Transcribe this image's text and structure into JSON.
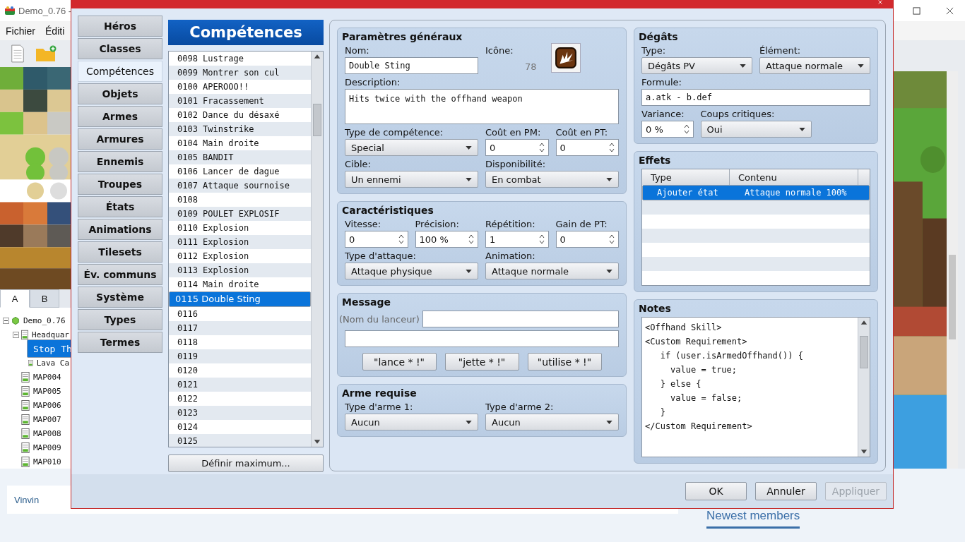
{
  "app": {
    "title": "Demo_0.76 -",
    "menu": [
      "Fichier",
      "Éditi"
    ],
    "palette_tabs": [
      {
        "label": "A",
        "selected": true
      },
      {
        "label": "B",
        "selected": false
      }
    ],
    "map_tree": [
      {
        "label": "Demo_0.76",
        "kind": "project",
        "expanded": true,
        "selected": false,
        "children": [
          {
            "label": "Headquar",
            "kind": "map",
            "expanded": true,
            "selected": false,
            "children": [
              {
                "label": "Stop Th",
                "kind": "map",
                "selected": true
              },
              {
                "label": "Lava Ca",
                "kind": "map",
                "selected": false
              }
            ]
          },
          {
            "label": "MAP004",
            "kind": "map",
            "selected": false
          },
          {
            "label": "MAP005",
            "kind": "map",
            "selected": false
          },
          {
            "label": "MAP006",
            "kind": "map",
            "selected": false
          },
          {
            "label": "MAP007",
            "kind": "map",
            "selected": false
          },
          {
            "label": "MAP008",
            "kind": "map",
            "selected": false
          },
          {
            "label": "MAP009",
            "kind": "map",
            "selected": false
          },
          {
            "label": "MAP010",
            "kind": "map",
            "selected": false
          }
        ]
      }
    ]
  },
  "web": {
    "post_author": "Vinvin",
    "sidebar_heading": "Newest members"
  },
  "dialog": {
    "nav": [
      {
        "label": "Héros",
        "selected": false
      },
      {
        "label": "Classes",
        "selected": false
      },
      {
        "label": "Compétences",
        "selected": true
      },
      {
        "label": "Objets",
        "selected": false
      },
      {
        "label": "Armes",
        "selected": false
      },
      {
        "label": "Armures",
        "selected": false
      },
      {
        "label": "Ennemis",
        "selected": false
      },
      {
        "label": "Troupes",
        "selected": false
      },
      {
        "label": "États",
        "selected": false
      },
      {
        "label": "Animations",
        "selected": false
      },
      {
        "label": "Tilesets",
        "selected": false
      },
      {
        "label": "Év. communs",
        "selected": false
      },
      {
        "label": "Système",
        "selected": false
      },
      {
        "label": "Types",
        "selected": false
      },
      {
        "label": "Termes",
        "selected": false
      }
    ],
    "list": {
      "title": "Compétences",
      "items": [
        {
          "label": "0098 Lustrage",
          "selected": false
        },
        {
          "label": "0099 Montrer son cul",
          "selected": false
        },
        {
          "label": "0100 APEROOO!!",
          "selected": false
        },
        {
          "label": "0101 Fracassement",
          "selected": false
        },
        {
          "label": "0102 Dance du désaxé",
          "selected": false
        },
        {
          "label": "0103 Twinstrike",
          "selected": false
        },
        {
          "label": "0104 Main droite",
          "selected": false
        },
        {
          "label": "0105 BANDIT",
          "selected": false
        },
        {
          "label": "0106 Lancer de dague",
          "selected": false
        },
        {
          "label": "0107 Attaque sournoise",
          "selected": false
        },
        {
          "label": "0108",
          "selected": false
        },
        {
          "label": "0109 POULET EXPLOSIF",
          "selected": false
        },
        {
          "label": "0110 Explosion",
          "selected": false
        },
        {
          "label": "0111 Explosion",
          "selected": false
        },
        {
          "label": "0112 Explosion",
          "selected": false
        },
        {
          "label": "0113 Explosion",
          "selected": false
        },
        {
          "label": "0114 Main droite",
          "selected": false
        },
        {
          "label": "0115 Double Sting",
          "selected": true
        },
        {
          "label": "0116",
          "selected": false
        },
        {
          "label": "0117",
          "selected": false
        },
        {
          "label": "0118",
          "selected": false
        },
        {
          "label": "0119",
          "selected": false
        },
        {
          "label": "0120",
          "selected": false
        },
        {
          "label": "0121",
          "selected": false
        },
        {
          "label": "0122",
          "selected": false
        },
        {
          "label": "0123",
          "selected": false
        },
        {
          "label": "0124",
          "selected": false
        },
        {
          "label": "0125",
          "selected": false
        }
      ],
      "max_button": "Définir maximum..."
    },
    "left_sections": [
      {
        "title": "Paramètres généraux",
        "rows": [
          {
            "fields": [
              {
                "kind": "text",
                "label": "Nom:",
                "value": "Double Sting"
              },
              {
                "kind": "icon",
                "label": "Icône:",
                "value": "78"
              }
            ]
          },
          {
            "fields": [
              {
                "kind": "textarea",
                "label": "Description:",
                "value": "Hits twice with the offhand weapon"
              }
            ]
          },
          {
            "fields": [
              {
                "kind": "select",
                "label": "Type de compétence:",
                "value": "Special"
              },
              {
                "kind": "spin",
                "label": "Coût en PM:",
                "value": "0"
              },
              {
                "kind": "spin",
                "label": "Coût en PT:",
                "value": "0"
              }
            ]
          },
          {
            "fields": [
              {
                "kind": "select",
                "label": "Cible:",
                "value": "Un ennemi"
              },
              {
                "kind": "select",
                "label": "Disponibilité:",
                "value": "En combat"
              }
            ]
          }
        ]
      },
      {
        "title": "Caractéristiques",
        "rows": [
          {
            "fields": [
              {
                "kind": "spin",
                "label": "Vitesse:",
                "value": "0"
              },
              {
                "kind": "spin",
                "label": "Précision:",
                "value": "100 %"
              },
              {
                "kind": "spin",
                "label": "Répétition:",
                "value": "1"
              },
              {
                "kind": "spin",
                "label": "Gain de PT:",
                "value": "0"
              }
            ]
          },
          {
            "fields": [
              {
                "kind": "select",
                "label": "Type d'attaque:",
                "value": "Attaque physique"
              },
              {
                "kind": "select",
                "label": "Animation:",
                "value": "Attaque normale"
              }
            ]
          }
        ]
      },
      {
        "title": "Message",
        "kind": "message",
        "caster_label": "(Nom du lanceur)",
        "buttons": [
          "\"lance * !\"",
          "\"jette * !\"",
          "\"utilise * !\""
        ]
      },
      {
        "title": "Arme requise",
        "rows": [
          {
            "fields": [
              {
                "kind": "select",
                "label": "Type d'arme 1:",
                "value": "Aucun"
              },
              {
                "kind": "select",
                "label": "Type d'arme 2:",
                "value": "Aucun"
              }
            ]
          }
        ]
      }
    ],
    "damage": {
      "title": "Dégâts",
      "rows": [
        {
          "fields": [
            {
              "kind": "select",
              "label": "Type:",
              "value": "Dégâts PV"
            },
            {
              "kind": "select",
              "label": "Élément:",
              "value": "Attaque normale"
            }
          ]
        },
        {
          "fields": [
            {
              "kind": "text",
              "label": "Formule:",
              "value": "a.atk - b.def"
            }
          ]
        },
        {
          "fields": [
            {
              "kind": "spin",
              "label": "Variance:",
              "value": "0 %"
            },
            {
              "kind": "select",
              "label": "Coups critiques:",
              "value": "Oui"
            }
          ]
        }
      ]
    },
    "effects": {
      "title": "Effets",
      "columns": [
        "Type",
        "Contenu"
      ],
      "rows": [
        {
          "cells": [
            "Ajouter état",
            "Attaque normale 100%"
          ],
          "selected": true
        }
      ]
    },
    "notes": {
      "title": "Notes",
      "lines": [
        "<Offhand Skill>",
        "<Custom Requirement>",
        "   if (user.isArmedOffhand()) {",
        "     value = true;",
        "   } else {",
        "     value = false;",
        "   }",
        "</Custom Requirement>"
      ]
    },
    "footer_buttons": [
      {
        "label": "OK",
        "disabled": false
      },
      {
        "label": "Annuler",
        "disabled": false
      },
      {
        "label": "Appliquer",
        "disabled": true
      }
    ]
  }
}
